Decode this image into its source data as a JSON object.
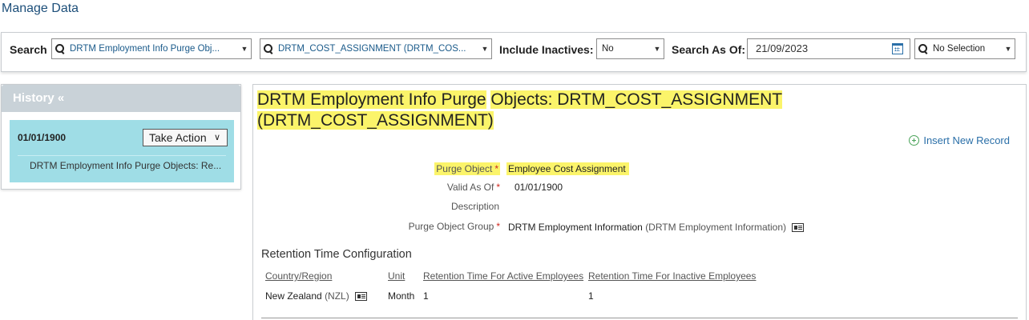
{
  "page": {
    "title": "Manage Data"
  },
  "search": {
    "label": "Search",
    "object_type": "DRTM Employment Info Purge Obj...",
    "object_instance": "DRTM_COST_ASSIGNMENT (DRTM_COS...",
    "include_inactives_label": "Include Inactives:",
    "include_inactives_value": "No",
    "search_as_of_label": "Search As Of:",
    "search_as_of_value": "21/09/2023",
    "filter_value": "No Selection"
  },
  "history": {
    "title": "History «",
    "entry": {
      "date": "01/01/1900",
      "action_label": "Take Action",
      "description": "DRTM Employment Info Purge Objects: Re..."
    }
  },
  "record": {
    "title_part1": "DRTM Employment Info Purge",
    "title_part2": "Objects: DRTM_COST_ASSIGNMENT",
    "title_part3": "(DRTM_COST_ASSIGNMENT)",
    "insert_label": "Insert New Record",
    "fields": {
      "purge_object_label": "Purge Object",
      "purge_object_value": "Employee Cost Assignment",
      "valid_as_of_label": "Valid As Of",
      "valid_as_of_value": "01/01/1900",
      "description_label": "Description",
      "purge_group_label": "Purge Object Group",
      "purge_group_value": "DRTM Employment Information",
      "purge_group_code": "(DRTM Employment Information)"
    },
    "required_mark": "*",
    "retention": {
      "title": "Retention Time Configuration",
      "columns": [
        "Country/Region",
        "Unit",
        "Retention Time For Active Employees",
        "Retention Time For Inactive Employees"
      ],
      "row": {
        "country": "New Zealand",
        "country_code": "(NZL)",
        "unit": "Month",
        "active": "1",
        "inactive": "1"
      }
    }
  },
  "icons": {
    "search": "search-icon",
    "caret": "caret-down-icon",
    "calendar": "calendar-icon",
    "add": "add-circle-icon",
    "quick_card": "quick-card-icon"
  },
  "colors": {
    "highlight": "#fbf46a",
    "history_card": "#9fdde6",
    "link": "#2a6fa8",
    "required": "#d0271d"
  }
}
